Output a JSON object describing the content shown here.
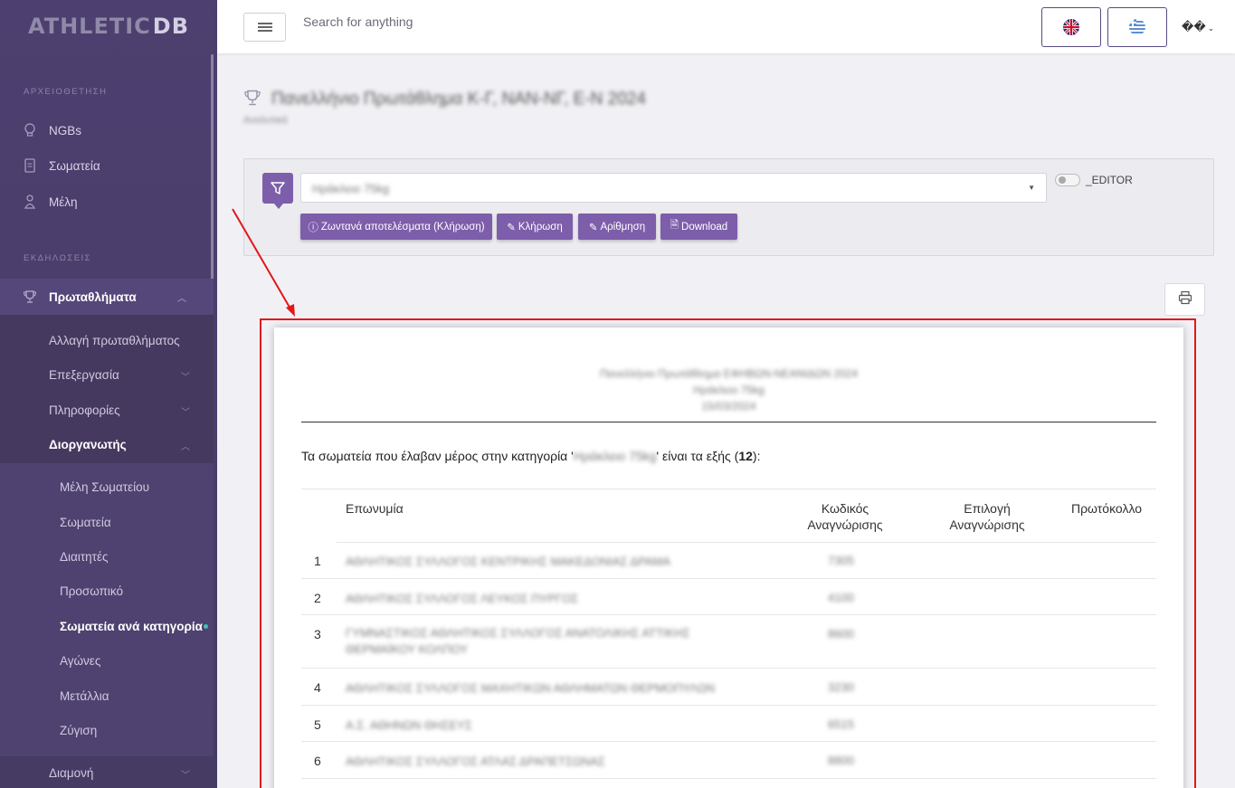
{
  "app": {
    "logo_part1": "ATHLETIC",
    "logo_part2": "DB"
  },
  "sidebar": {
    "section_archive": "ΑΡΧΕΙΟΘΕΤΗΣΗ",
    "archive_items": [
      {
        "label": "NGBs",
        "icon": "lightbulb-icon"
      },
      {
        "label": "Σωματεία",
        "icon": "document-icon"
      },
      {
        "label": "Μέλη",
        "icon": "person-icon"
      }
    ],
    "section_events": "ΕΚΔΗΛΩΣΕΙΣ",
    "championships": "Πρωταθλήματα",
    "sub_items": [
      {
        "label": "Αλλαγή πρωταθλήματος"
      },
      {
        "label": "Επεξεργασία"
      },
      {
        "label": "Πληροφορίες"
      },
      {
        "label": "Διοργανωτής"
      }
    ],
    "organizer_items": [
      {
        "label": "Μέλη Σωματείου"
      },
      {
        "label": "Σωματεία"
      },
      {
        "label": "Διαιτητές"
      },
      {
        "label": "Προσωπικό"
      },
      {
        "label": "Σωματεία ανά κατηγορία"
      },
      {
        "label": "Αγώνες"
      },
      {
        "label": "Μετάλλια"
      },
      {
        "label": "Ζύγιση"
      }
    ],
    "accommodation": "Διαμονή"
  },
  "topbar": {
    "search_placeholder": "Search for anything",
    "user_label": "��"
  },
  "page": {
    "title": "Πανελλήνιο Πρωτάθλημα Κ-Γ, ΝΑΝ-ΝΓ, Ε-Ν 2024",
    "subtitle": "Αναλυτικά"
  },
  "filter": {
    "selected": "Ηράκλειο 75kg",
    "editor_label": "_EDITOR",
    "buttons": {
      "live": "Ζωντανά αποτελέσματα (Κλήρωση)",
      "draw": "Κλήρωση",
      "numbering": "Αρίθμηση",
      "download": "Download"
    }
  },
  "document": {
    "head_line1": "Πανελλήνιο Πρωτάθλημα ΕΦΗΒΩΝ-ΝΕΑΝΙΔΩΝ 2024",
    "head_line2": "Ηράκλειο 75kg",
    "head_line3": "15/03/2024",
    "intro_prefix": "Τα σωματεία που έλαβαν μέρος στην κατηγορία '",
    "intro_category": "Ηράκλειο 75kg",
    "intro_suffix": "' είναι τα εξής (",
    "intro_count": "12",
    "intro_end": "):",
    "columns": {
      "name": "Επωνυμία",
      "code": "Κωδικός Αναγνώρισης",
      "choice": "Επιλογή Αναγνώρισης",
      "protocol": "Πρωτόκολλο"
    },
    "rows": [
      {
        "num": "1",
        "name": "ΑΘΛΗΤΙΚΟΣ ΣΥΛΛΟΓΟΣ ΚΕΝΤΡΙΚΗΣ ΜΑΚΕΔΟΝΙΑΣ ΔΡΑΜΑ",
        "code": "7305"
      },
      {
        "num": "2",
        "name": "ΑΘΛΗΤΙΚΟΣ ΣΥΛΛΟΓΟΣ ΛΕΥΚΟΣ ΠΥΡΓΟΣ",
        "code": "4100"
      },
      {
        "num": "3",
        "name": "ΓΥΜΝΑΣΤΙΚΟΣ ΑΘΛΗΤΙΚΟΣ ΣΥΛΛΟΓΟΣ ΑΝΑΤΟΛΙΚΗΣ ΑΤΤΙΚΗΣ ΘΕΡΜΑΪΚΟΥ ΚΟΛΠΟΥ",
        "code": "8600"
      },
      {
        "num": "4",
        "name": "ΑΘΛΗΤΙΚΟΣ ΣΥΛΛΟΓΟΣ ΜΑΧΗΤΙΚΩΝ ΑΘΛΗΜΑΤΩΝ ΘΕΡΜΟΠΥΛΩΝ",
        "code": "3230"
      },
      {
        "num": "5",
        "name": "Α.Σ. ΑΘΗΝΩΝ ΘΗΣΕΥΣ",
        "code": "6515"
      },
      {
        "num": "6",
        "name": "ΑΘΛΗΤΙΚΟΣ ΣΥΛΛΟΓΟΣ ΑΤΛΑΣ ΔΡΑΠΕΤΣΩΝΑΣ",
        "code": "8800"
      }
    ]
  },
  "colors": {
    "accent": "#7d5eaa",
    "sidebar": "#4a3d6a",
    "annotation": "#e01919"
  }
}
